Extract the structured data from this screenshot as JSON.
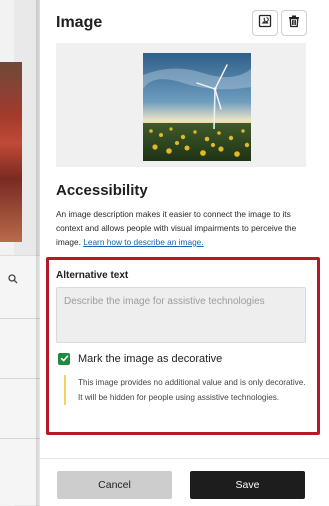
{
  "panel": {
    "title": "Image",
    "toolbar": {
      "replace_icon": "image-replace-icon",
      "delete_icon": "trash-icon"
    },
    "preview": {
      "icon": "wind-turbine-sunflower-field-photo"
    }
  },
  "accessibility": {
    "heading": "Accessibility",
    "description": "An image description makes it easier to connect the image to its context and allows people with visual impairments to perceive the image. ",
    "link_text": "Learn how to describe an image.",
    "alt_text": {
      "label": "Alternative text",
      "value": "",
      "placeholder": "Describe the image for assistive technologies"
    },
    "decorative": {
      "checked": true,
      "label": "Mark the image as decorative",
      "note": "This image provides no additional value and is only decorative. It will be hidden for people using assistive technologies."
    }
  },
  "footer": {
    "cancel_label": "Cancel",
    "save_label": "Save"
  },
  "background": {
    "search_icon": "search-icon"
  },
  "colors": {
    "highlight": "#b31b22",
    "checkbox": "#1e8a3e",
    "link": "#1a62b4",
    "note_accent": "#f3d35a",
    "save_button": "#1d1d1d",
    "cancel_button": "#cdcdcd"
  }
}
